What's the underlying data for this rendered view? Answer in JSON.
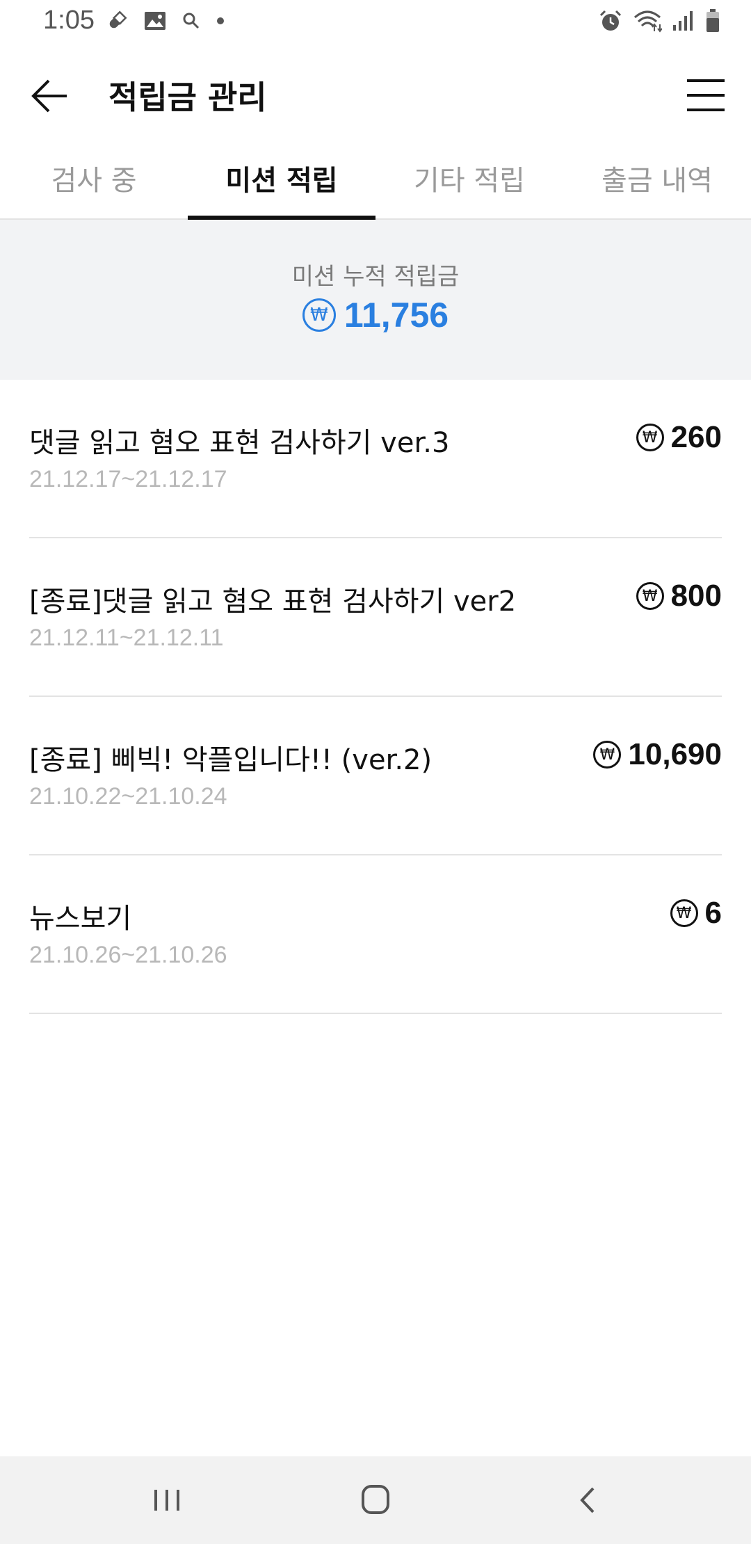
{
  "status_bar": {
    "time": "1:05",
    "left_icons": [
      "pill-icon",
      "gallery-icon",
      "search-icon",
      "dot-icon"
    ],
    "right_icons": [
      "alarm-icon",
      "wifi-icon",
      "signal-icon",
      "battery-icon"
    ]
  },
  "header": {
    "title": "적립금 관리",
    "back_icon": "arrow-left-icon",
    "menu_icon": "hamburger-menu-icon"
  },
  "tabs": [
    {
      "label": "검사 중",
      "active": false
    },
    {
      "label": "미션 적립",
      "active": true
    },
    {
      "label": "기타 적립",
      "active": false
    },
    {
      "label": "출금 내역",
      "active": false
    }
  ],
  "summary": {
    "label": "미션 누적 적립금",
    "currency_symbol": "₩",
    "amount": "11,756",
    "accent_color": "#2a7fe0"
  },
  "missions": [
    {
      "title": "댓글 읽고 혐오 표현 검사하기 ver.3",
      "date": "21.12.17~21.12.17",
      "amount": "260"
    },
    {
      "title": "[종료]댓글 읽고 혐오 표현 검사하기 ver2",
      "date": "21.12.11~21.12.11",
      "amount": "800"
    },
    {
      "title": "[종료] 삐빅! 악플입니다!! (ver.2)",
      "date": "21.10.22~21.10.24",
      "amount": "10,690"
    },
    {
      "title": "뉴스보기",
      "date": "21.10.26~21.10.26",
      "amount": "6"
    }
  ],
  "currency_symbol": "₩",
  "nav_bar": {
    "items": [
      "recent-apps-icon",
      "home-icon",
      "back-icon"
    ]
  }
}
